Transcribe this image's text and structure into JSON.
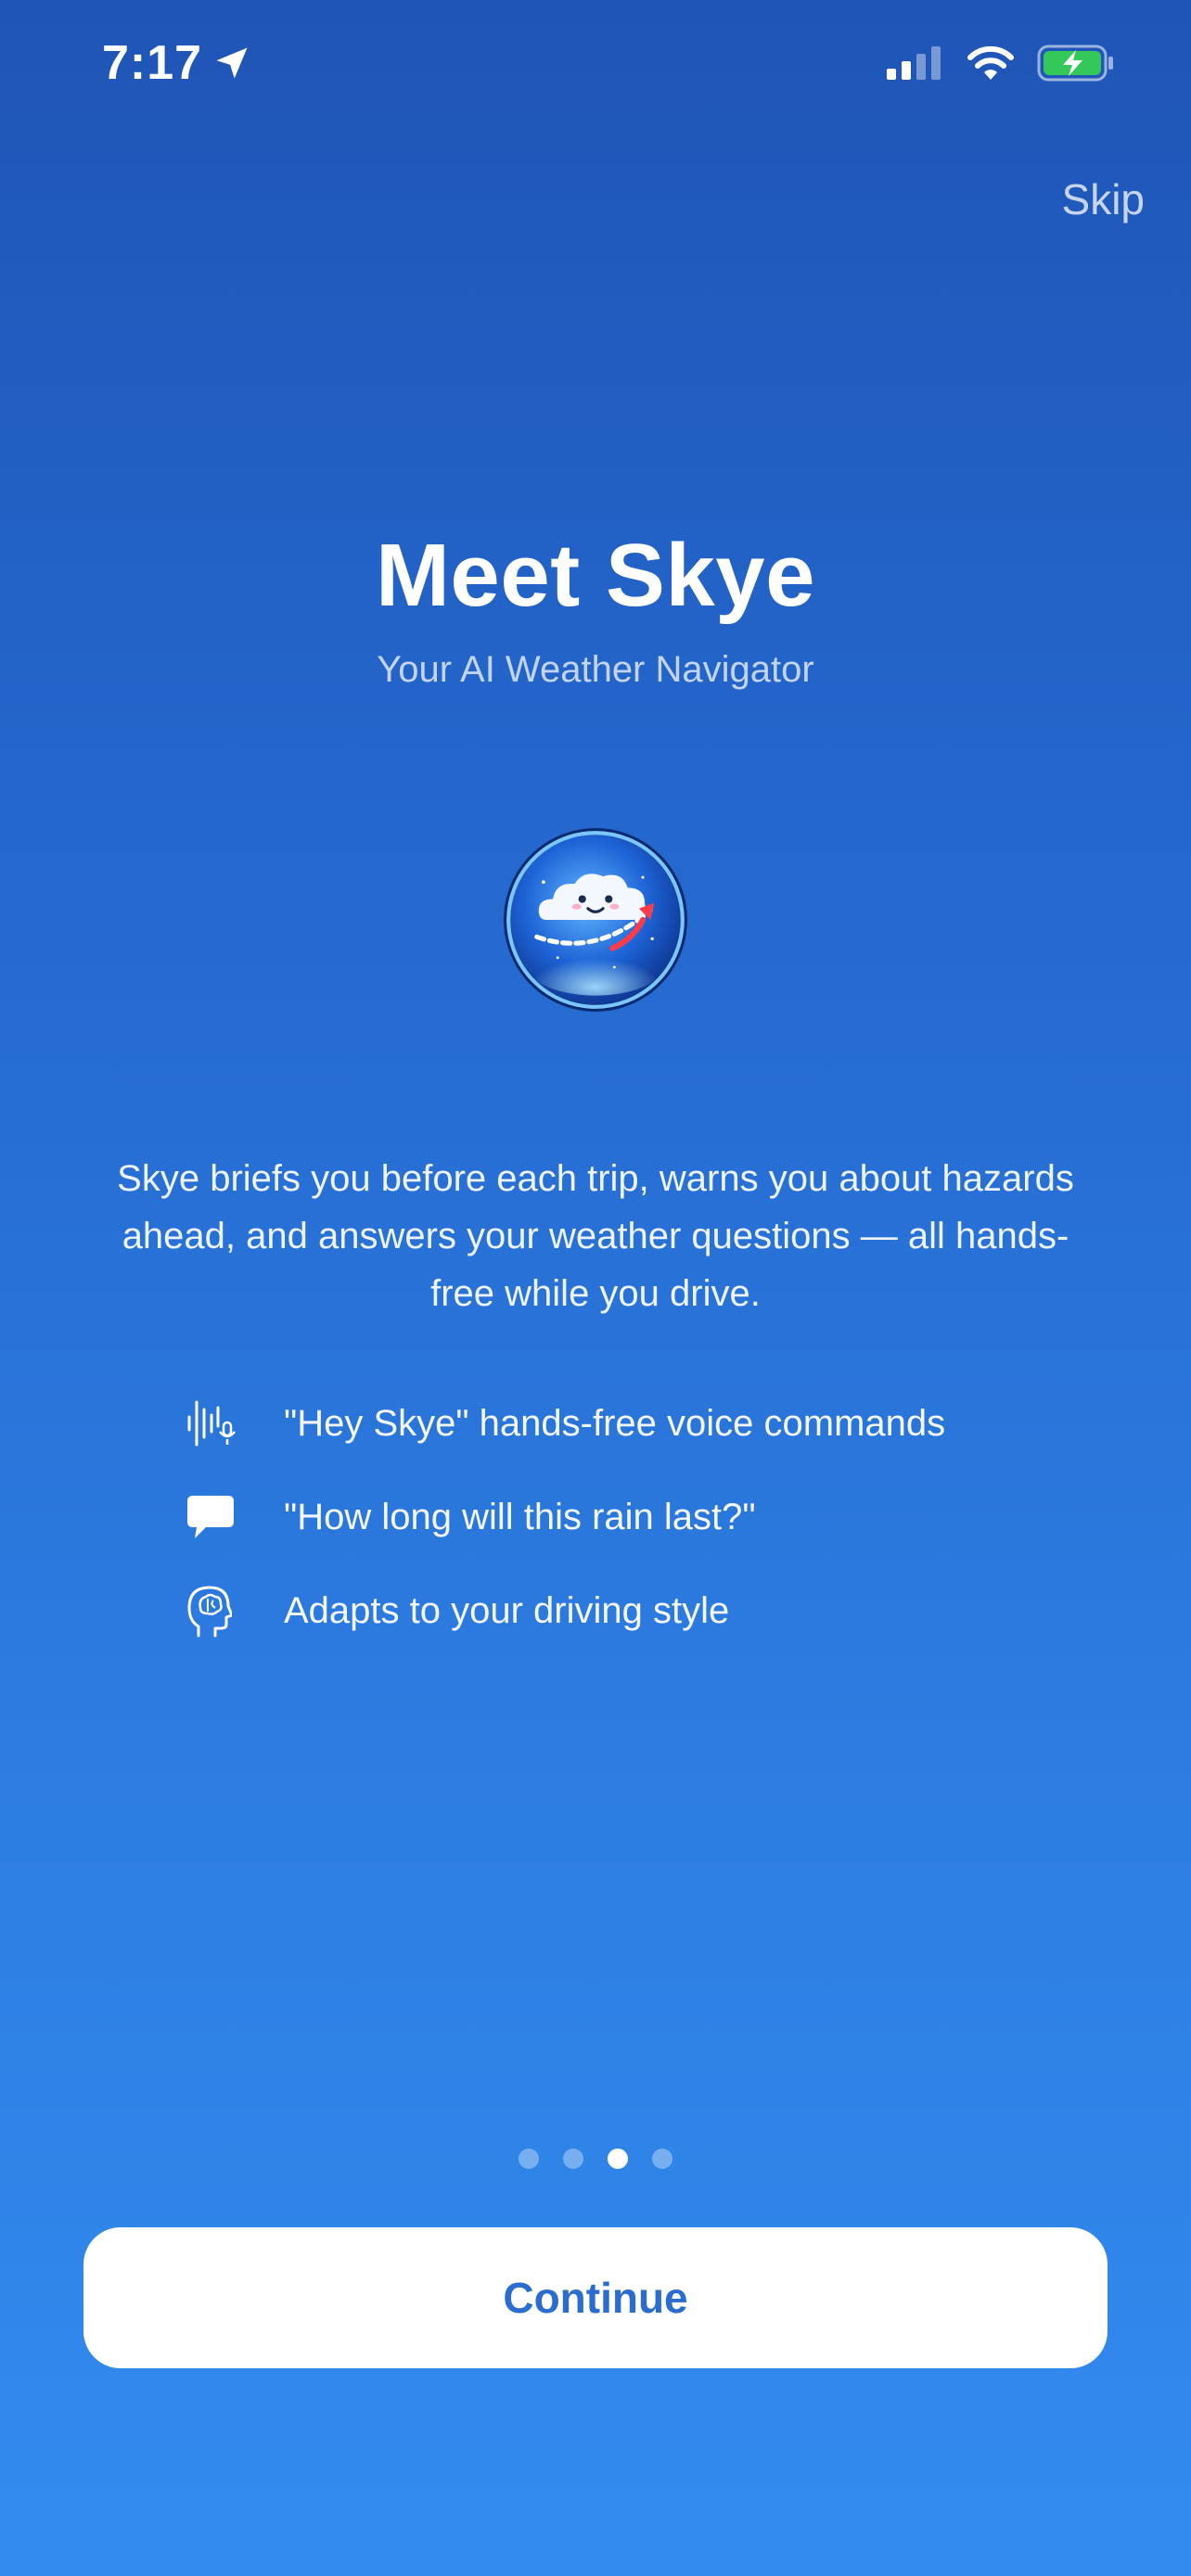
{
  "status_bar": {
    "time": "7:17",
    "location_icon": "location-arrow-icon",
    "signal_icon": "cellular-signal-icon",
    "wifi_icon": "wifi-icon",
    "battery_icon": "battery-charging-icon"
  },
  "nav": {
    "skip_label": "Skip"
  },
  "hero": {
    "title": "Meet Skye",
    "subtitle": "Your AI Weather Navigator",
    "logo_icon": "skye-cloud-logo-icon"
  },
  "description": "Skye briefs you before each trip, warns you about hazards ahead, and answers your weather questions — all hands-free while you drive.",
  "features": [
    {
      "icon": "voice-waveform-icon",
      "text": "\"Hey Skye\" hands-free voice commands"
    },
    {
      "icon": "chat-bubble-icon",
      "text": "\"How long will this rain last?\""
    },
    {
      "icon": "brain-head-icon",
      "text": "Adapts to your driving style"
    }
  ],
  "pagination": {
    "total": 4,
    "current": 3
  },
  "actions": {
    "continue_label": "Continue"
  },
  "colors": {
    "background_top": "#1f55b6",
    "background_bottom": "#338bef",
    "button_text": "#2b6cd0",
    "battery_fill": "#34c759"
  }
}
